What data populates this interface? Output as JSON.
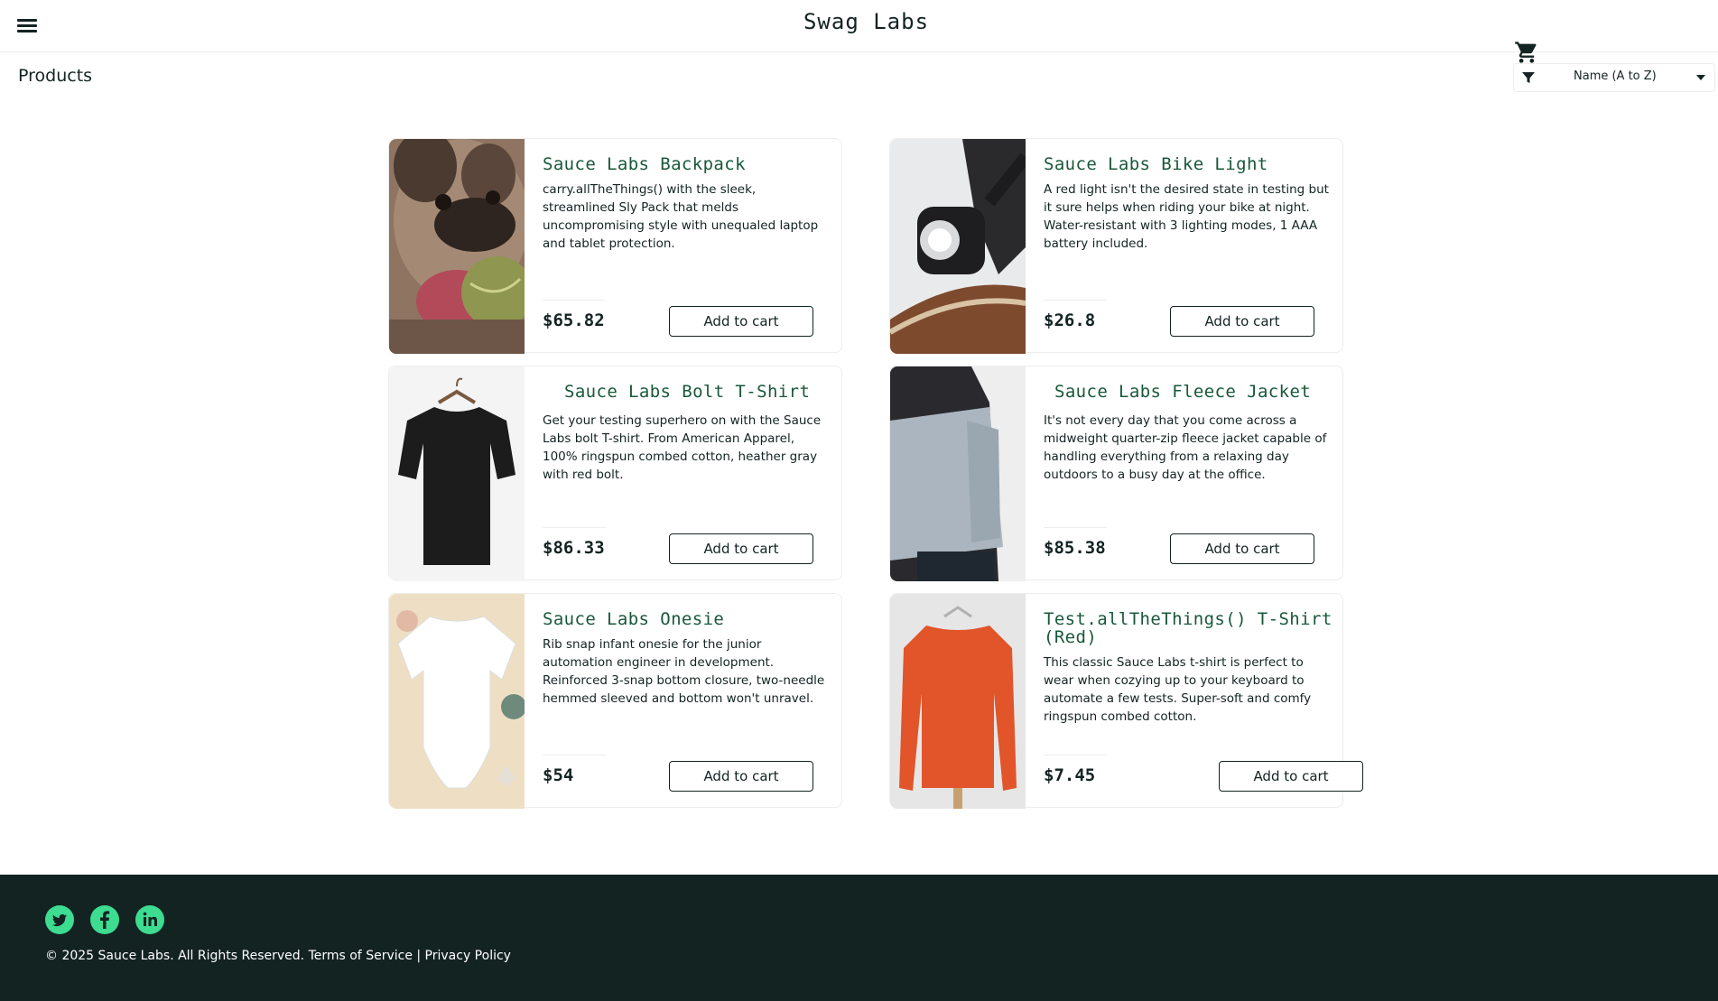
{
  "header": {
    "app_logo": "Swag Labs",
    "menu_icon": "hamburger-menu-icon",
    "cart_icon": "shopping-cart-icon"
  },
  "subheader": {
    "title": "Products",
    "sort_icon": "filter-icon",
    "sort_value": "Name (A to Z)"
  },
  "products": [
    {
      "name": "Sauce Labs Backpack",
      "desc": "carry.allTheThings() with the sleek, streamlined Sly Pack that melds uncompromising style with unequaled laptop and tablet protection.",
      "price": "$65.82",
      "button": "Add to cart"
    },
    {
      "name": "Sauce Labs Bike Light",
      "desc": "A red light isn't the desired state in testing but it sure helps when riding your bike at night. Water-resistant with 3 lighting modes, 1 AAA battery included.",
      "price": "$26.8",
      "button": "Add to cart"
    },
    {
      "name": "Sauce Labs Bolt T-Shirt",
      "desc": "Get your testing superhero on with the Sauce Labs bolt T-shirt. From American Apparel, 100% ringspun combed cotton, heather gray with red bolt.",
      "price": "$86.33",
      "button": "Add to cart"
    },
    {
      "name": "Sauce Labs Fleece Jacket",
      "desc": "It's not every day that you come across a midweight quarter-zip fleece jacket capable of handling everything from a relaxing day outdoors to a busy day at the office.",
      "price": "$85.38",
      "button": "Add to cart"
    },
    {
      "name": "Sauce Labs Onesie",
      "desc": "Rib snap infant onesie for the junior automation engineer in development. Reinforced 3-snap bottom closure, two-needle hemmed sleeved and bottom won't unravel.",
      "price": "$54",
      "button": "Add to cart"
    },
    {
      "name": "Test.allTheThings() T-Shirt (Red)",
      "desc": "This classic Sauce Labs t-shirt is perfect to wear when cozying up to your keyboard to automate a few tests. Super-soft and comfy ringspun combed cotton.",
      "price": "$7.45",
      "button": "Add to cart"
    }
  ],
  "footer": {
    "social": [
      "twitter-icon",
      "facebook-icon",
      "linkedin-icon"
    ],
    "copyright": "© 2025 Sauce Labs. All Rights Reserved. Terms of Service | Privacy Policy"
  },
  "colors": {
    "brand_dark": "#132322",
    "product_name": "#18583a",
    "social_green": "#3ddc91"
  }
}
